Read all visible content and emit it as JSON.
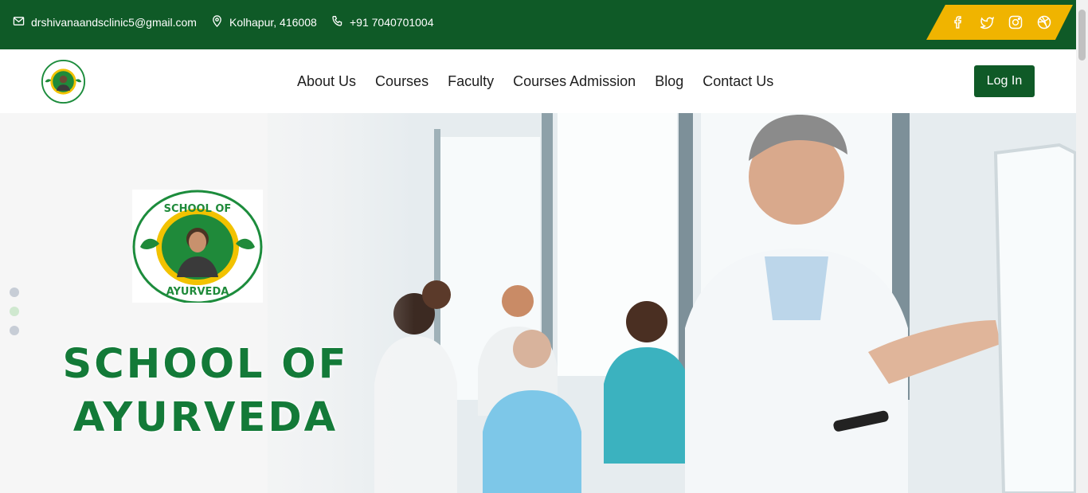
{
  "topbar": {
    "email": "drshivanaandsclinic5@gmail.com",
    "location": "Kolhapur, 416008",
    "phone": "+91 7040701004",
    "social": [
      "facebook-icon",
      "twitter-icon",
      "instagram-icon",
      "dribbble-icon"
    ],
    "colors": {
      "bar": "#0f5a27",
      "social_bg": "#f0b400"
    }
  },
  "nav": {
    "items": [
      "About Us",
      "Courses",
      "Faculty",
      "Courses Admission",
      "Blog",
      "Contact Us"
    ],
    "login": "Log In"
  },
  "logo": {
    "top_text": "SCHOOL OF",
    "bottom_text": "AYURVEDA"
  },
  "hero": {
    "title_line1": "SCHOOL OF",
    "title_line2": "AYURVEDA",
    "slider": {
      "count": 3,
      "active": 2
    }
  }
}
